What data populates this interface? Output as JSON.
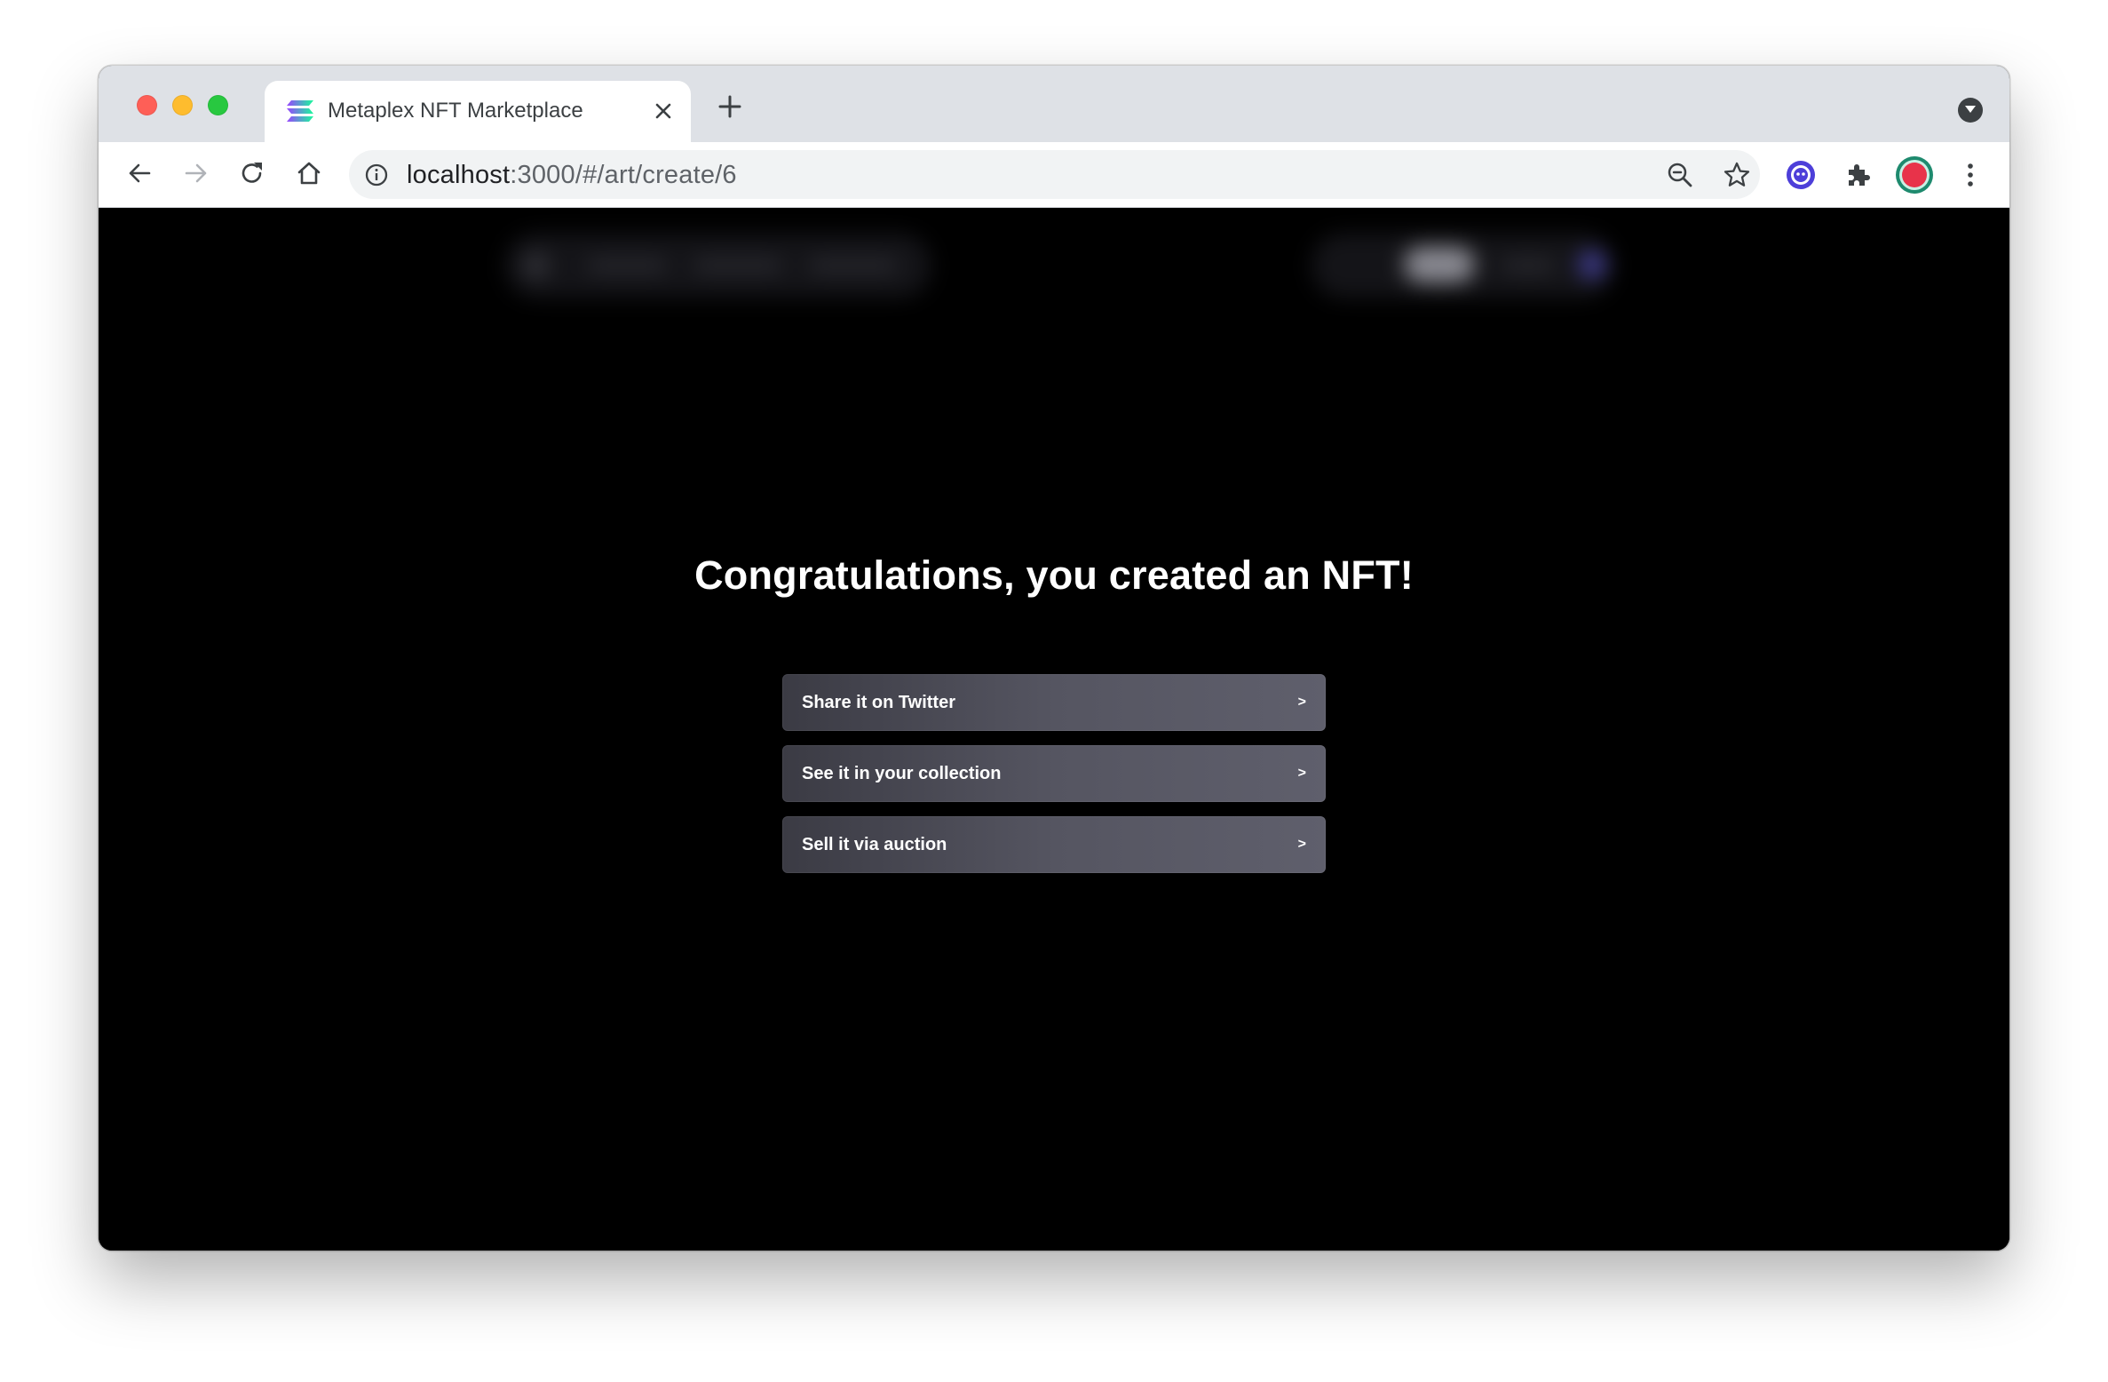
{
  "browser": {
    "tab_title": "Metaplex NFT Marketplace",
    "url_host": "localhost",
    "url_path": ":3000/#/art/create/6",
    "colors": {
      "tabstrip": "#dee1e6",
      "omnibox": "#f1f3f4",
      "traffic_red": "#fe5f57",
      "traffic_yellow": "#febc2e",
      "traffic_green": "#28c840",
      "extension_purple": "#4d3fd9",
      "profile_ring": "#1e8a6e",
      "profile_fill": "#e8334a"
    },
    "icons": {
      "tab_favicon": "solana-logo-icon",
      "close": "close-icon",
      "new_tab": "plus-icon",
      "back": "arrow-left-icon",
      "forward": "arrow-right-icon",
      "reload": "reload-icon",
      "home": "home-icon",
      "site_info": "info-icon",
      "zoom": "zoom-out-icon",
      "bookmark": "star-icon",
      "extension": "phantom-wallet-icon",
      "extensions": "puzzle-icon",
      "profile": "avatar",
      "menu": "kebab-menu-icon"
    }
  },
  "page": {
    "background": "#000000",
    "heading": "Congratulations, you created an NFT!",
    "actions": [
      {
        "label": "Share it on Twitter",
        "chevron": ">"
      },
      {
        "label": "See it in your collection",
        "chevron": ">"
      },
      {
        "label": "Sell it via auction",
        "chevron": ">"
      }
    ]
  }
}
